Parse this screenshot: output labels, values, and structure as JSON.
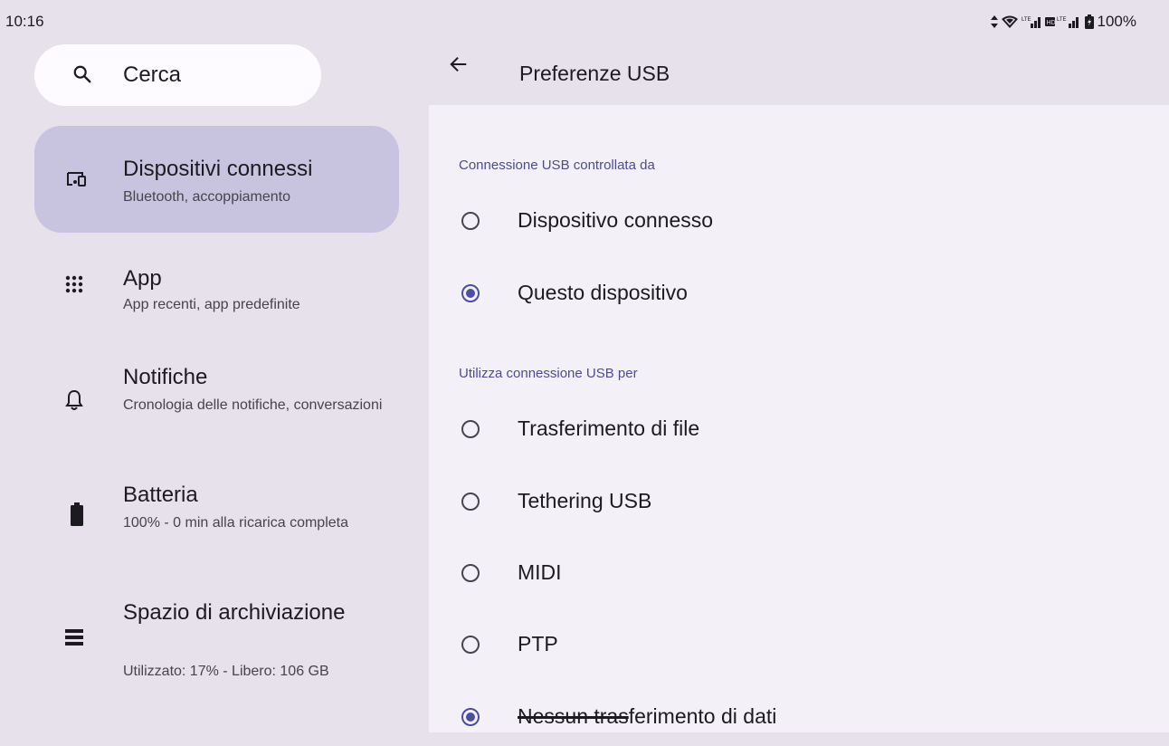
{
  "status_bar": {
    "time": "10:16",
    "battery": "100%",
    "icons": [
      "data-arrows-icon",
      "wifi-icon",
      "lte-signal-icon",
      "hd-lte-signal-icon",
      "battery-icon"
    ]
  },
  "search": {
    "placeholder": "Cerca"
  },
  "sidebar": {
    "items": [
      {
        "title": "Dispositivi connessi",
        "subtitle": "Bluetooth, accoppiamento",
        "icon": "devices-icon"
      },
      {
        "title": "App",
        "subtitle": "App recenti, app predefinite",
        "icon": "apps-grid-icon"
      },
      {
        "title": "Notifiche",
        "subtitle": "Cronologia delle notifiche, conversazioni",
        "icon": "bell-icon"
      },
      {
        "title": "Batteria",
        "subtitle": "100% - 0 min alla ricarica completa",
        "icon": "battery-icon"
      },
      {
        "title": "Spazio di archiviazione",
        "subtitle": "Utilizzato: 17% - Libero: 106 GB",
        "icon": "storage-icon"
      }
    ]
  },
  "main": {
    "title": "Preferenze USB",
    "section1": {
      "label": "Connessione USB controllata da",
      "options": [
        {
          "label": "Dispositivo connesso",
          "checked": false
        },
        {
          "label": "Questo dispositivo",
          "checked": true
        }
      ]
    },
    "section2": {
      "label": "Utilizza connessione USB per",
      "options": [
        {
          "label": "Trasferimento di file",
          "checked": false
        },
        {
          "label": "Tethering USB",
          "checked": false
        },
        {
          "label": "MIDI",
          "checked": false
        },
        {
          "label": "PTP",
          "checked": false
        },
        {
          "label_a": "Nessun tras",
          "label_b": "ferimento di dati",
          "checked": true
        }
      ]
    }
  },
  "colors": {
    "accent": "#4a4fa3",
    "active_item": "#c8c3df",
    "section_label": "#4e4c8e"
  }
}
